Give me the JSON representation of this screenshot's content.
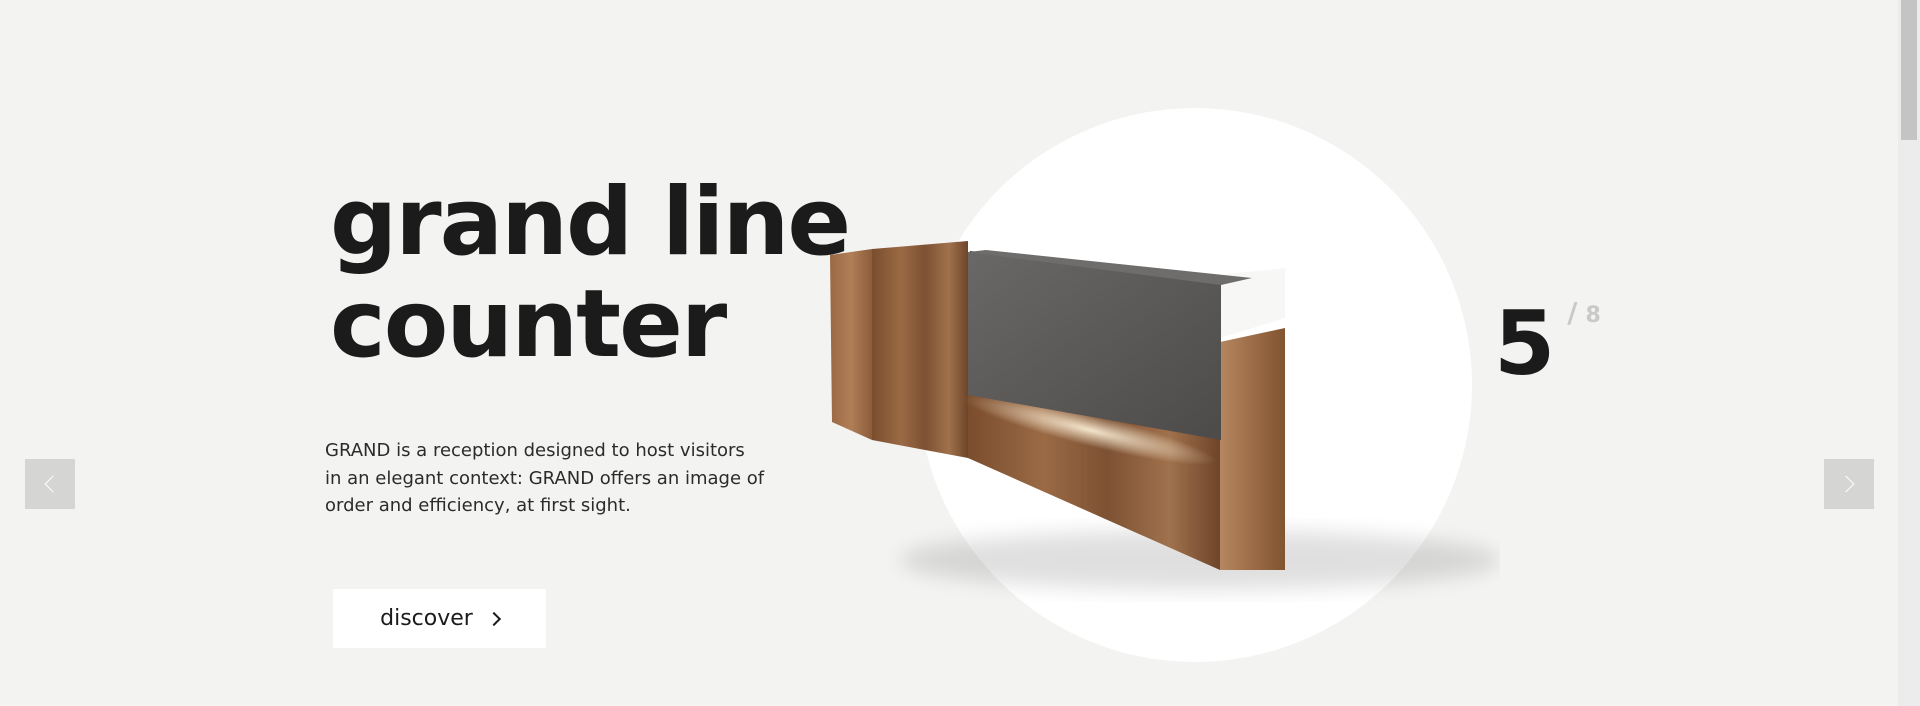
{
  "slide": {
    "title_line1": "grand line",
    "title_line2": "counter",
    "description": "GRAND is a reception designed to host visitors in an elegant context: GRAND offers an image of order and efficiency, at first sight.",
    "cta_label": "discover",
    "counter": {
      "current": "5",
      "separator": "/",
      "total": "8"
    }
  },
  "navigation": {
    "prev_icon": "chevron-left-icon",
    "next_icon": "chevron-right-icon"
  },
  "colors": {
    "background": "#f3f3f1",
    "text": "#1b1b1b",
    "muted": "#c9c9c9",
    "nav_button": "#d5d5d3",
    "wood": "#8a5a36",
    "panel": "#5a5856"
  }
}
